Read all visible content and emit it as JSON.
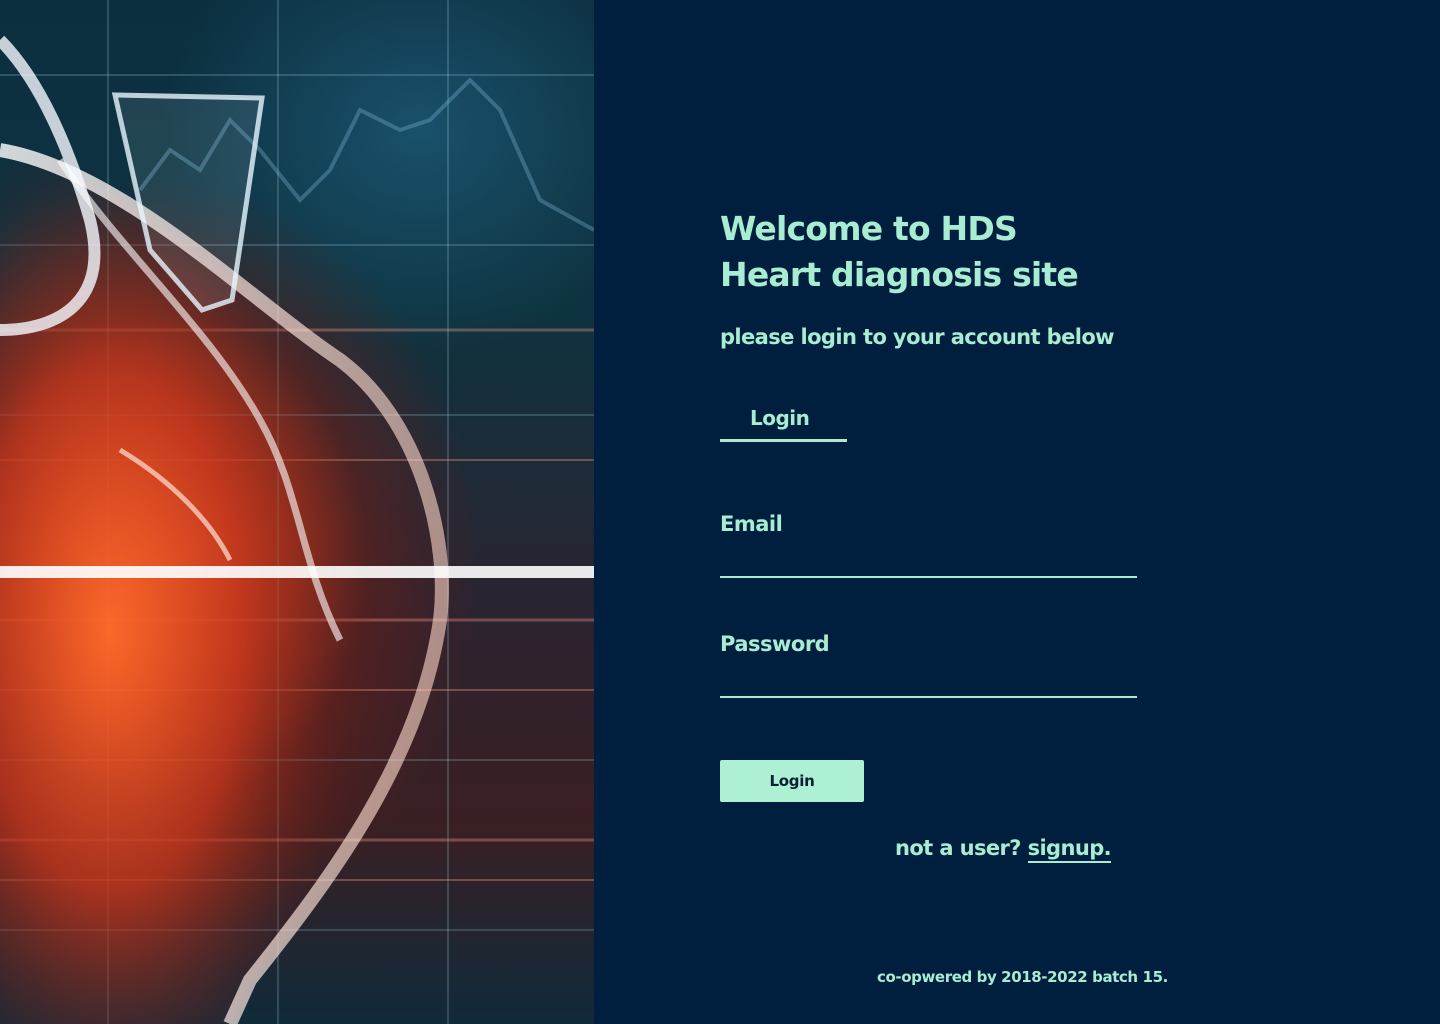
{
  "header": {
    "title_line1": "Welcome to HDS",
    "title_line2": "Heart diagnosis site",
    "subtitle": "please login to your account below"
  },
  "tabs": {
    "active_label": "Login"
  },
  "form": {
    "email_label": "Email",
    "email_value": "",
    "password_label": "Password",
    "password_value": "",
    "submit_label": "Login"
  },
  "signup": {
    "prompt": "not a user?",
    "link_label": "signup."
  },
  "footer": {
    "text": "co-opwered by 2018-2022 batch 15."
  },
  "theme": {
    "background": "#001f3f",
    "accent": "#a8ecd2",
    "button_bg": "#aef0d4"
  },
  "hero": {
    "image": "heart-illustration"
  }
}
